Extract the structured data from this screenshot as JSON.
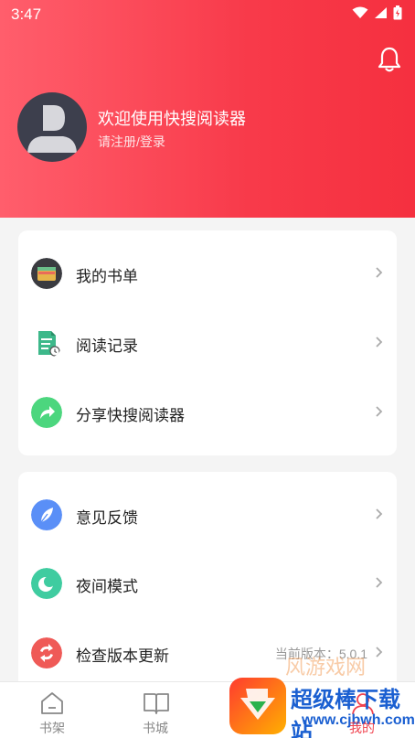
{
  "status_bar": {
    "time": "3:47"
  },
  "header": {
    "welcome": "欢迎使用快搜阅读器",
    "login": "请注册/登录"
  },
  "menu_group_1": [
    {
      "label": "我的书单",
      "icon": "wallet-icon"
    },
    {
      "label": "阅读记录",
      "icon": "document-icon"
    },
    {
      "label": "分享快搜阅读器",
      "icon": "share-icon"
    }
  ],
  "menu_group_2": [
    {
      "label": "意见反馈",
      "icon": "feather-icon"
    },
    {
      "label": "夜间模式",
      "icon": "moon-icon"
    },
    {
      "label": "检查版本更新",
      "icon": "refresh-icon",
      "extra": "当前版本：5.0.1"
    }
  ],
  "tabbar": [
    {
      "label": "书架",
      "icon": "house-icon"
    },
    {
      "label": "书城",
      "icon": "book-icon"
    },
    {
      "label": "",
      "icon": ""
    },
    {
      "label": "我的",
      "icon": "user-icon"
    }
  ],
  "watermark": {
    "text1": "超级棒下载站",
    "text2": "www.cjbwh.com",
    "faint": "风游戏网"
  },
  "colors": {
    "header_red": "#f83a4a",
    "accent_red": "#f0434f"
  }
}
